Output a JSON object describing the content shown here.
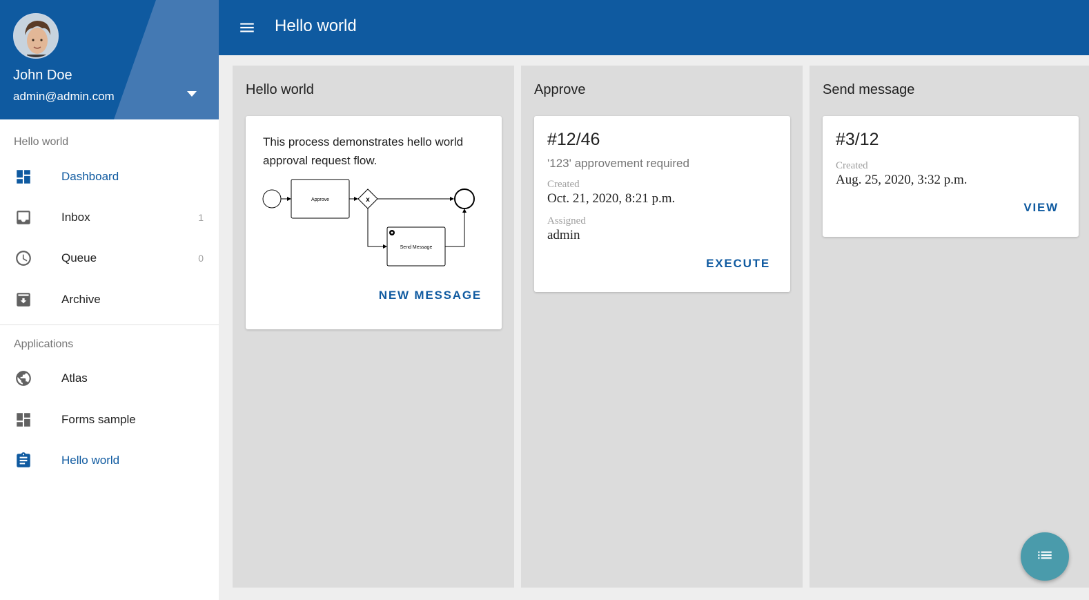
{
  "sidebar": {
    "user": {
      "name": "John Doe",
      "email": "admin@admin.com"
    },
    "sections": [
      {
        "header": "Hello world"
      },
      {
        "header": "Applications"
      }
    ],
    "items": [
      {
        "label": "Dashboard",
        "icon": "dashboard-icon",
        "active": true
      },
      {
        "label": "Inbox",
        "icon": "inbox-icon",
        "count": "1"
      },
      {
        "label": "Queue",
        "icon": "clock-icon",
        "count": "0"
      },
      {
        "label": "Archive",
        "icon": "archive-icon"
      },
      {
        "label": "Atlas",
        "icon": "globe-icon"
      },
      {
        "label": "Forms sample",
        "icon": "dashboard-icon"
      },
      {
        "label": "Hello world",
        "icon": "clipboard-icon",
        "active": true
      }
    ]
  },
  "header": {
    "title": "Hello world",
    "menu_icon": "hamburger-menu-icon"
  },
  "columns": [
    {
      "title": "Hello world",
      "card": {
        "description": "This process demonstrates hello world approval request flow.",
        "diagram": {
          "task1": "Approve",
          "gateway": "x",
          "task2": "Send Message"
        },
        "action": "NEW MESSAGE"
      }
    },
    {
      "title": "Approve",
      "card": {
        "id": "#12/46",
        "subtitle": "'123' approvement required",
        "created_label": "Created",
        "created_value": "Oct. 21, 2020, 8:21 p.m.",
        "assigned_label": "Assigned",
        "assigned_value": "admin",
        "action": "EXECUTE"
      }
    },
    {
      "title": "Send message",
      "card": {
        "id": "#3/12",
        "created_label": "Created",
        "created_value": "Aug. 25, 2020, 3:32 p.m.",
        "action": "VIEW"
      }
    }
  ],
  "fab": {
    "icon": "list-icon"
  },
  "colors": {
    "primary": "#0f5aa0",
    "fab": "#4a9bab",
    "column_bg": "#dcdcdc"
  }
}
